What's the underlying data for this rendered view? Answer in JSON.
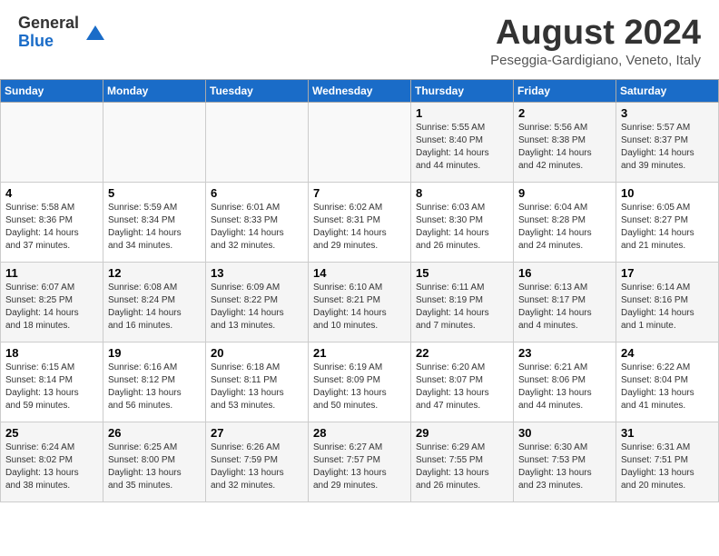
{
  "header": {
    "logo_general": "General",
    "logo_blue": "Blue",
    "month_year": "August 2024",
    "location": "Peseggia-Gardigiano, Veneto, Italy"
  },
  "weekdays": [
    "Sunday",
    "Monday",
    "Tuesday",
    "Wednesday",
    "Thursday",
    "Friday",
    "Saturday"
  ],
  "weeks": [
    [
      {
        "day": "",
        "info": ""
      },
      {
        "day": "",
        "info": ""
      },
      {
        "day": "",
        "info": ""
      },
      {
        "day": "",
        "info": ""
      },
      {
        "day": "1",
        "info": "Sunrise: 5:55 AM\nSunset: 8:40 PM\nDaylight: 14 hours\nand 44 minutes."
      },
      {
        "day": "2",
        "info": "Sunrise: 5:56 AM\nSunset: 8:38 PM\nDaylight: 14 hours\nand 42 minutes."
      },
      {
        "day": "3",
        "info": "Sunrise: 5:57 AM\nSunset: 8:37 PM\nDaylight: 14 hours\nand 39 minutes."
      }
    ],
    [
      {
        "day": "4",
        "info": "Sunrise: 5:58 AM\nSunset: 8:36 PM\nDaylight: 14 hours\nand 37 minutes."
      },
      {
        "day": "5",
        "info": "Sunrise: 5:59 AM\nSunset: 8:34 PM\nDaylight: 14 hours\nand 34 minutes."
      },
      {
        "day": "6",
        "info": "Sunrise: 6:01 AM\nSunset: 8:33 PM\nDaylight: 14 hours\nand 32 minutes."
      },
      {
        "day": "7",
        "info": "Sunrise: 6:02 AM\nSunset: 8:31 PM\nDaylight: 14 hours\nand 29 minutes."
      },
      {
        "day": "8",
        "info": "Sunrise: 6:03 AM\nSunset: 8:30 PM\nDaylight: 14 hours\nand 26 minutes."
      },
      {
        "day": "9",
        "info": "Sunrise: 6:04 AM\nSunset: 8:28 PM\nDaylight: 14 hours\nand 24 minutes."
      },
      {
        "day": "10",
        "info": "Sunrise: 6:05 AM\nSunset: 8:27 PM\nDaylight: 14 hours\nand 21 minutes."
      }
    ],
    [
      {
        "day": "11",
        "info": "Sunrise: 6:07 AM\nSunset: 8:25 PM\nDaylight: 14 hours\nand 18 minutes."
      },
      {
        "day": "12",
        "info": "Sunrise: 6:08 AM\nSunset: 8:24 PM\nDaylight: 14 hours\nand 16 minutes."
      },
      {
        "day": "13",
        "info": "Sunrise: 6:09 AM\nSunset: 8:22 PM\nDaylight: 14 hours\nand 13 minutes."
      },
      {
        "day": "14",
        "info": "Sunrise: 6:10 AM\nSunset: 8:21 PM\nDaylight: 14 hours\nand 10 minutes."
      },
      {
        "day": "15",
        "info": "Sunrise: 6:11 AM\nSunset: 8:19 PM\nDaylight: 14 hours\nand 7 minutes."
      },
      {
        "day": "16",
        "info": "Sunrise: 6:13 AM\nSunset: 8:17 PM\nDaylight: 14 hours\nand 4 minutes."
      },
      {
        "day": "17",
        "info": "Sunrise: 6:14 AM\nSunset: 8:16 PM\nDaylight: 14 hours\nand 1 minute."
      }
    ],
    [
      {
        "day": "18",
        "info": "Sunrise: 6:15 AM\nSunset: 8:14 PM\nDaylight: 13 hours\nand 59 minutes."
      },
      {
        "day": "19",
        "info": "Sunrise: 6:16 AM\nSunset: 8:12 PM\nDaylight: 13 hours\nand 56 minutes."
      },
      {
        "day": "20",
        "info": "Sunrise: 6:18 AM\nSunset: 8:11 PM\nDaylight: 13 hours\nand 53 minutes."
      },
      {
        "day": "21",
        "info": "Sunrise: 6:19 AM\nSunset: 8:09 PM\nDaylight: 13 hours\nand 50 minutes."
      },
      {
        "day": "22",
        "info": "Sunrise: 6:20 AM\nSunset: 8:07 PM\nDaylight: 13 hours\nand 47 minutes."
      },
      {
        "day": "23",
        "info": "Sunrise: 6:21 AM\nSunset: 8:06 PM\nDaylight: 13 hours\nand 44 minutes."
      },
      {
        "day": "24",
        "info": "Sunrise: 6:22 AM\nSunset: 8:04 PM\nDaylight: 13 hours\nand 41 minutes."
      }
    ],
    [
      {
        "day": "25",
        "info": "Sunrise: 6:24 AM\nSunset: 8:02 PM\nDaylight: 13 hours\nand 38 minutes."
      },
      {
        "day": "26",
        "info": "Sunrise: 6:25 AM\nSunset: 8:00 PM\nDaylight: 13 hours\nand 35 minutes."
      },
      {
        "day": "27",
        "info": "Sunrise: 6:26 AM\nSunset: 7:59 PM\nDaylight: 13 hours\nand 32 minutes."
      },
      {
        "day": "28",
        "info": "Sunrise: 6:27 AM\nSunset: 7:57 PM\nDaylight: 13 hours\nand 29 minutes."
      },
      {
        "day": "29",
        "info": "Sunrise: 6:29 AM\nSunset: 7:55 PM\nDaylight: 13 hours\nand 26 minutes."
      },
      {
        "day": "30",
        "info": "Sunrise: 6:30 AM\nSunset: 7:53 PM\nDaylight: 13 hours\nand 23 minutes."
      },
      {
        "day": "31",
        "info": "Sunrise: 6:31 AM\nSunset: 7:51 PM\nDaylight: 13 hours\nand 20 minutes."
      }
    ]
  ]
}
